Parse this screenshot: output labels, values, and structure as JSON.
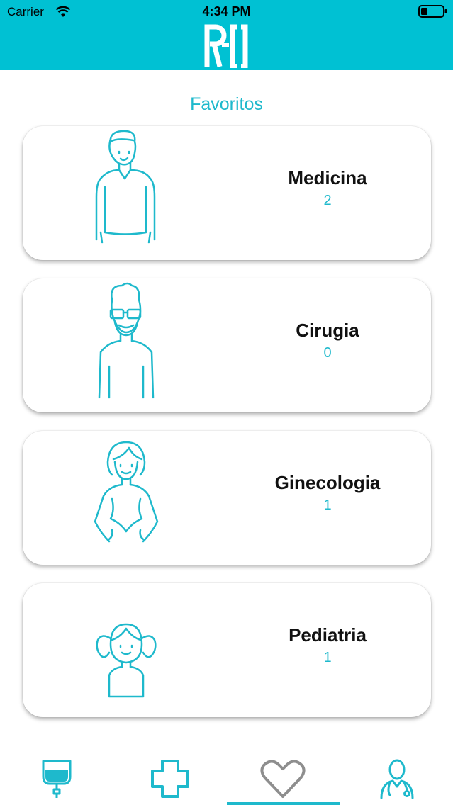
{
  "status_bar": {
    "carrier": "Carrier",
    "time": "4:34 PM"
  },
  "header": {
    "logo_text": "R-O",
    "background": "#00c1d3"
  },
  "page": {
    "title": "Favoritos",
    "accent": "#1eb9cc"
  },
  "favorites": [
    {
      "name": "Medicina",
      "count": "2",
      "figure": "man-icon"
    },
    {
      "name": "Cirugia",
      "count": "0",
      "figure": "bearded-man-glasses-icon"
    },
    {
      "name": "Ginecologia",
      "count": "1",
      "figure": "pregnant-woman-icon"
    },
    {
      "name": "Pediatria",
      "count": "1",
      "figure": "girl-icon"
    }
  ],
  "tabbar": {
    "items": [
      {
        "icon": "iv-bag-icon"
      },
      {
        "icon": "medical-cross-icon"
      },
      {
        "icon": "heart-icon",
        "selected": true
      },
      {
        "icon": "doctor-icon"
      }
    ]
  }
}
